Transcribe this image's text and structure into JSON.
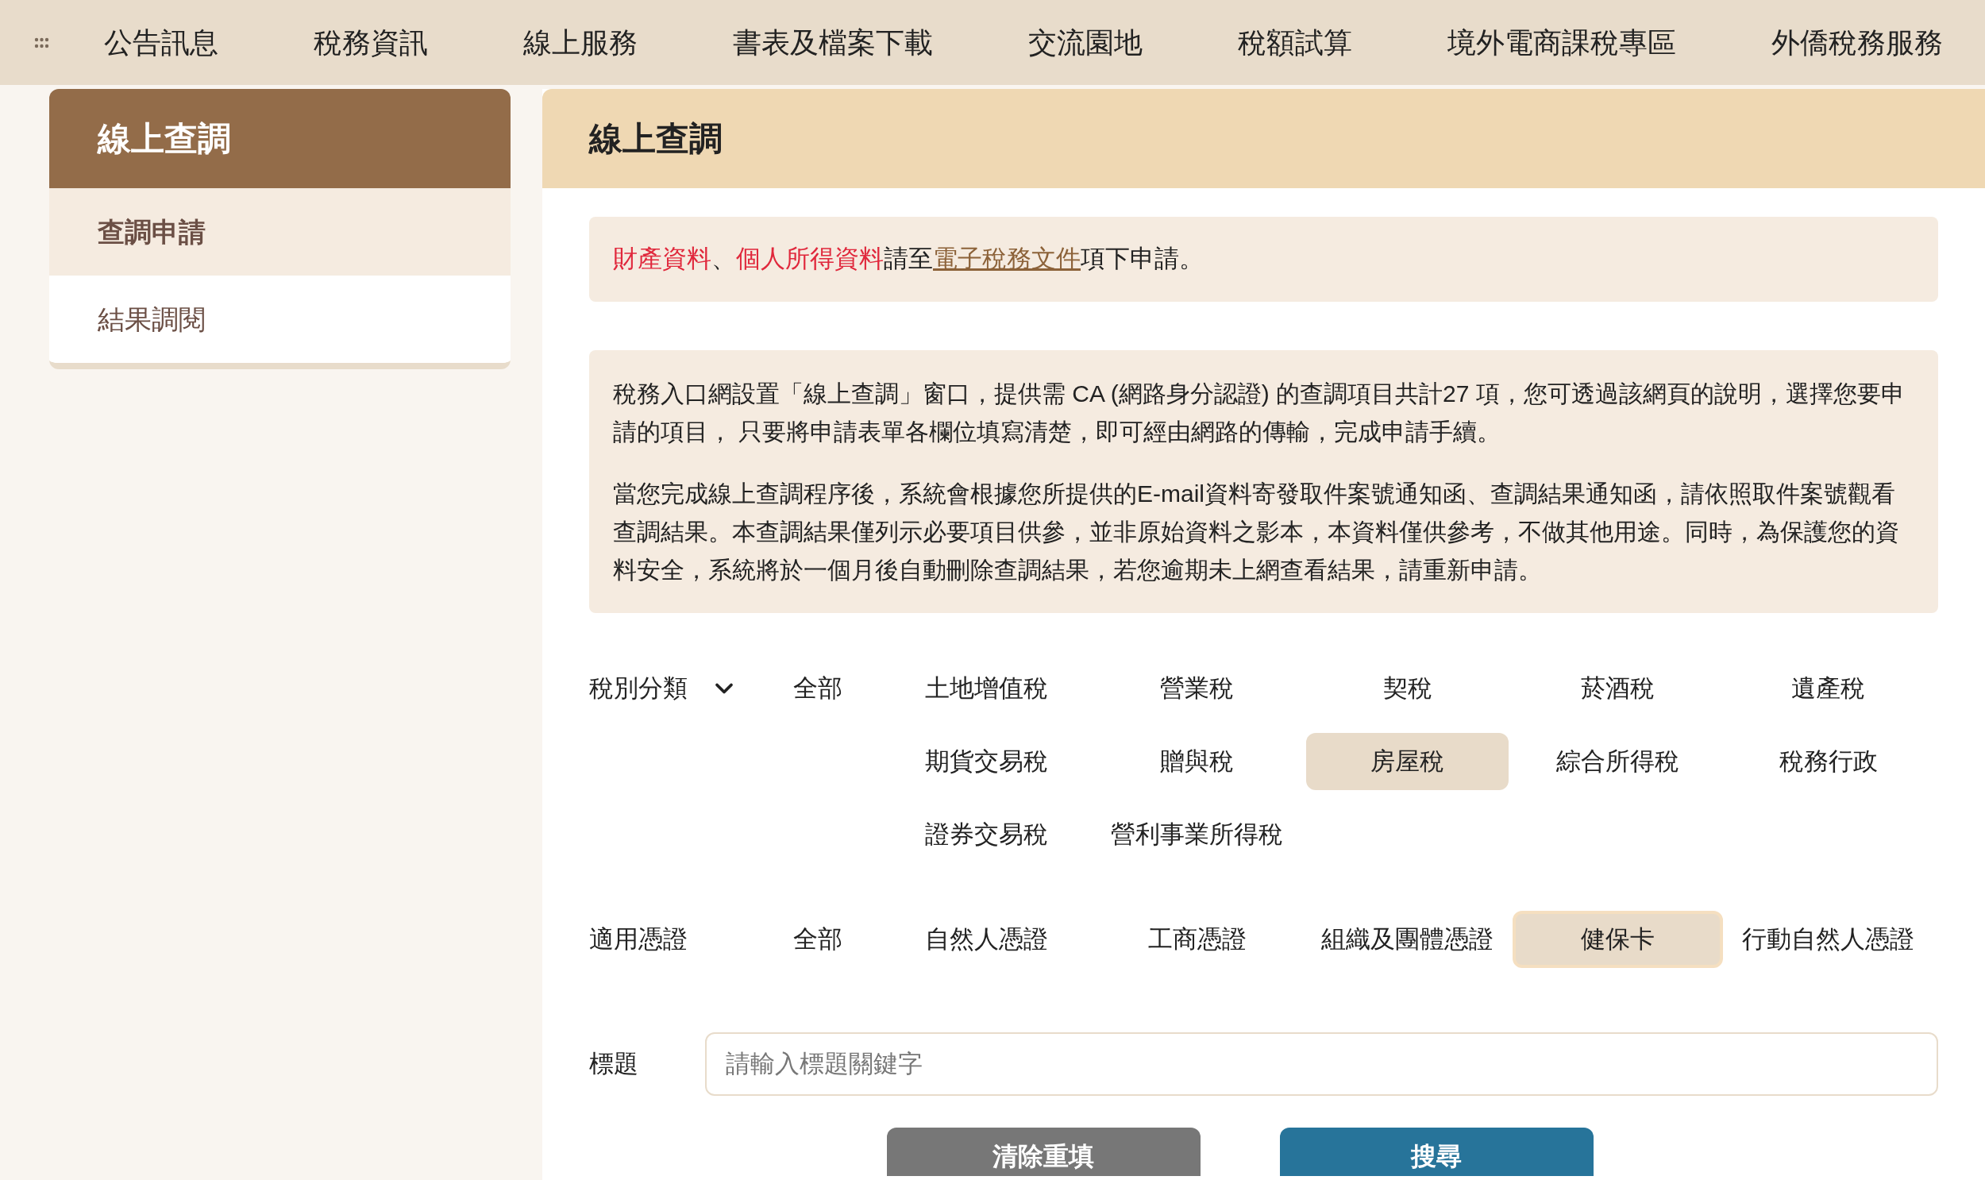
{
  "nav": {
    "items": [
      {
        "label": "公告訊息"
      },
      {
        "label": "稅務資訊"
      },
      {
        "label": "線上服務"
      },
      {
        "label": "書表及檔案下載"
      },
      {
        "label": "交流園地"
      },
      {
        "label": "稅額試算"
      },
      {
        "label": "境外電商課稅專區"
      },
      {
        "label": "外僑稅務服務"
      }
    ]
  },
  "sidebar": {
    "title": "線上查調",
    "items": [
      {
        "label": "查調申請",
        "selected": true
      },
      {
        "label": "結果調閱",
        "selected": false
      }
    ]
  },
  "main": {
    "title": "線上查調",
    "notice": [
      {
        "text": "財產資料",
        "kind": "highlight"
      },
      {
        "text": "、",
        "kind": "plain"
      },
      {
        "text": "個人所得資料",
        "kind": "highlight"
      },
      {
        "text": "請至",
        "kind": "plain"
      },
      {
        "text": "電子稅務文件",
        "kind": "link"
      },
      {
        "text": "項下申請。",
        "kind": "plain"
      }
    ],
    "description": [
      "稅務入口網設置「線上查調」窗口，提供需 CA (網路身分認證) 的查調項目共計27 項，您可透過該網頁的說明，選擇您要申請的項目， 只要將申請表單各欄位填寫清楚，即可經由網路的傳輸，完成申請手續。",
      "當您完成線上查調程序後，系統會根據您所提供的E-mail資料寄發取件案號通知函、查調結果通知函，請依照取件案號觀看查調結果。本查調結果僅列示必要項目供參，並非原始資料之影本，本資料僅供參考，不做其他用途。同時，為保護您的資料安全，系統將於一個月後自動刪除查調結果，若您逾期未上網查看結果，請重新申請。"
    ],
    "filters": [
      {
        "label": "稅別分類",
        "dropdown": true,
        "all": {
          "label": "全部",
          "selected": false
        },
        "options": [
          {
            "label": "土地增值稅",
            "selected": false
          },
          {
            "label": "營業稅",
            "selected": false
          },
          {
            "label": "契稅",
            "selected": false
          },
          {
            "label": "菸酒稅",
            "selected": false
          },
          {
            "label": "遺產稅",
            "selected": false
          },
          {
            "label": "期貨交易稅",
            "selected": false
          },
          {
            "label": "贈與稅",
            "selected": false
          },
          {
            "label": "房屋稅",
            "selected": true
          },
          {
            "label": "綜合所得稅",
            "selected": false
          },
          {
            "label": "稅務行政",
            "selected": false
          },
          {
            "label": "證券交易稅",
            "selected": false
          },
          {
            "label": "營利事業所得稅",
            "selected": false
          }
        ]
      },
      {
        "label": "適用憑證",
        "dropdown": false,
        "all": {
          "label": "全部",
          "selected": false
        },
        "options": [
          {
            "label": "自然人憑證",
            "selected": false
          },
          {
            "label": "工商憑證",
            "selected": false
          },
          {
            "label": "組織及團體憑證",
            "selected": false
          },
          {
            "label": "健保卡",
            "selected": true
          },
          {
            "label": "行動自然人憑證",
            "selected": false
          }
        ]
      }
    ],
    "title_field": {
      "label": "標題",
      "placeholder": "請輸入標題關鍵字"
    },
    "buttons": [
      {
        "label": "清除重填",
        "kind": "reset"
      },
      {
        "label": "搜尋",
        "kind": "search"
      }
    ]
  }
}
